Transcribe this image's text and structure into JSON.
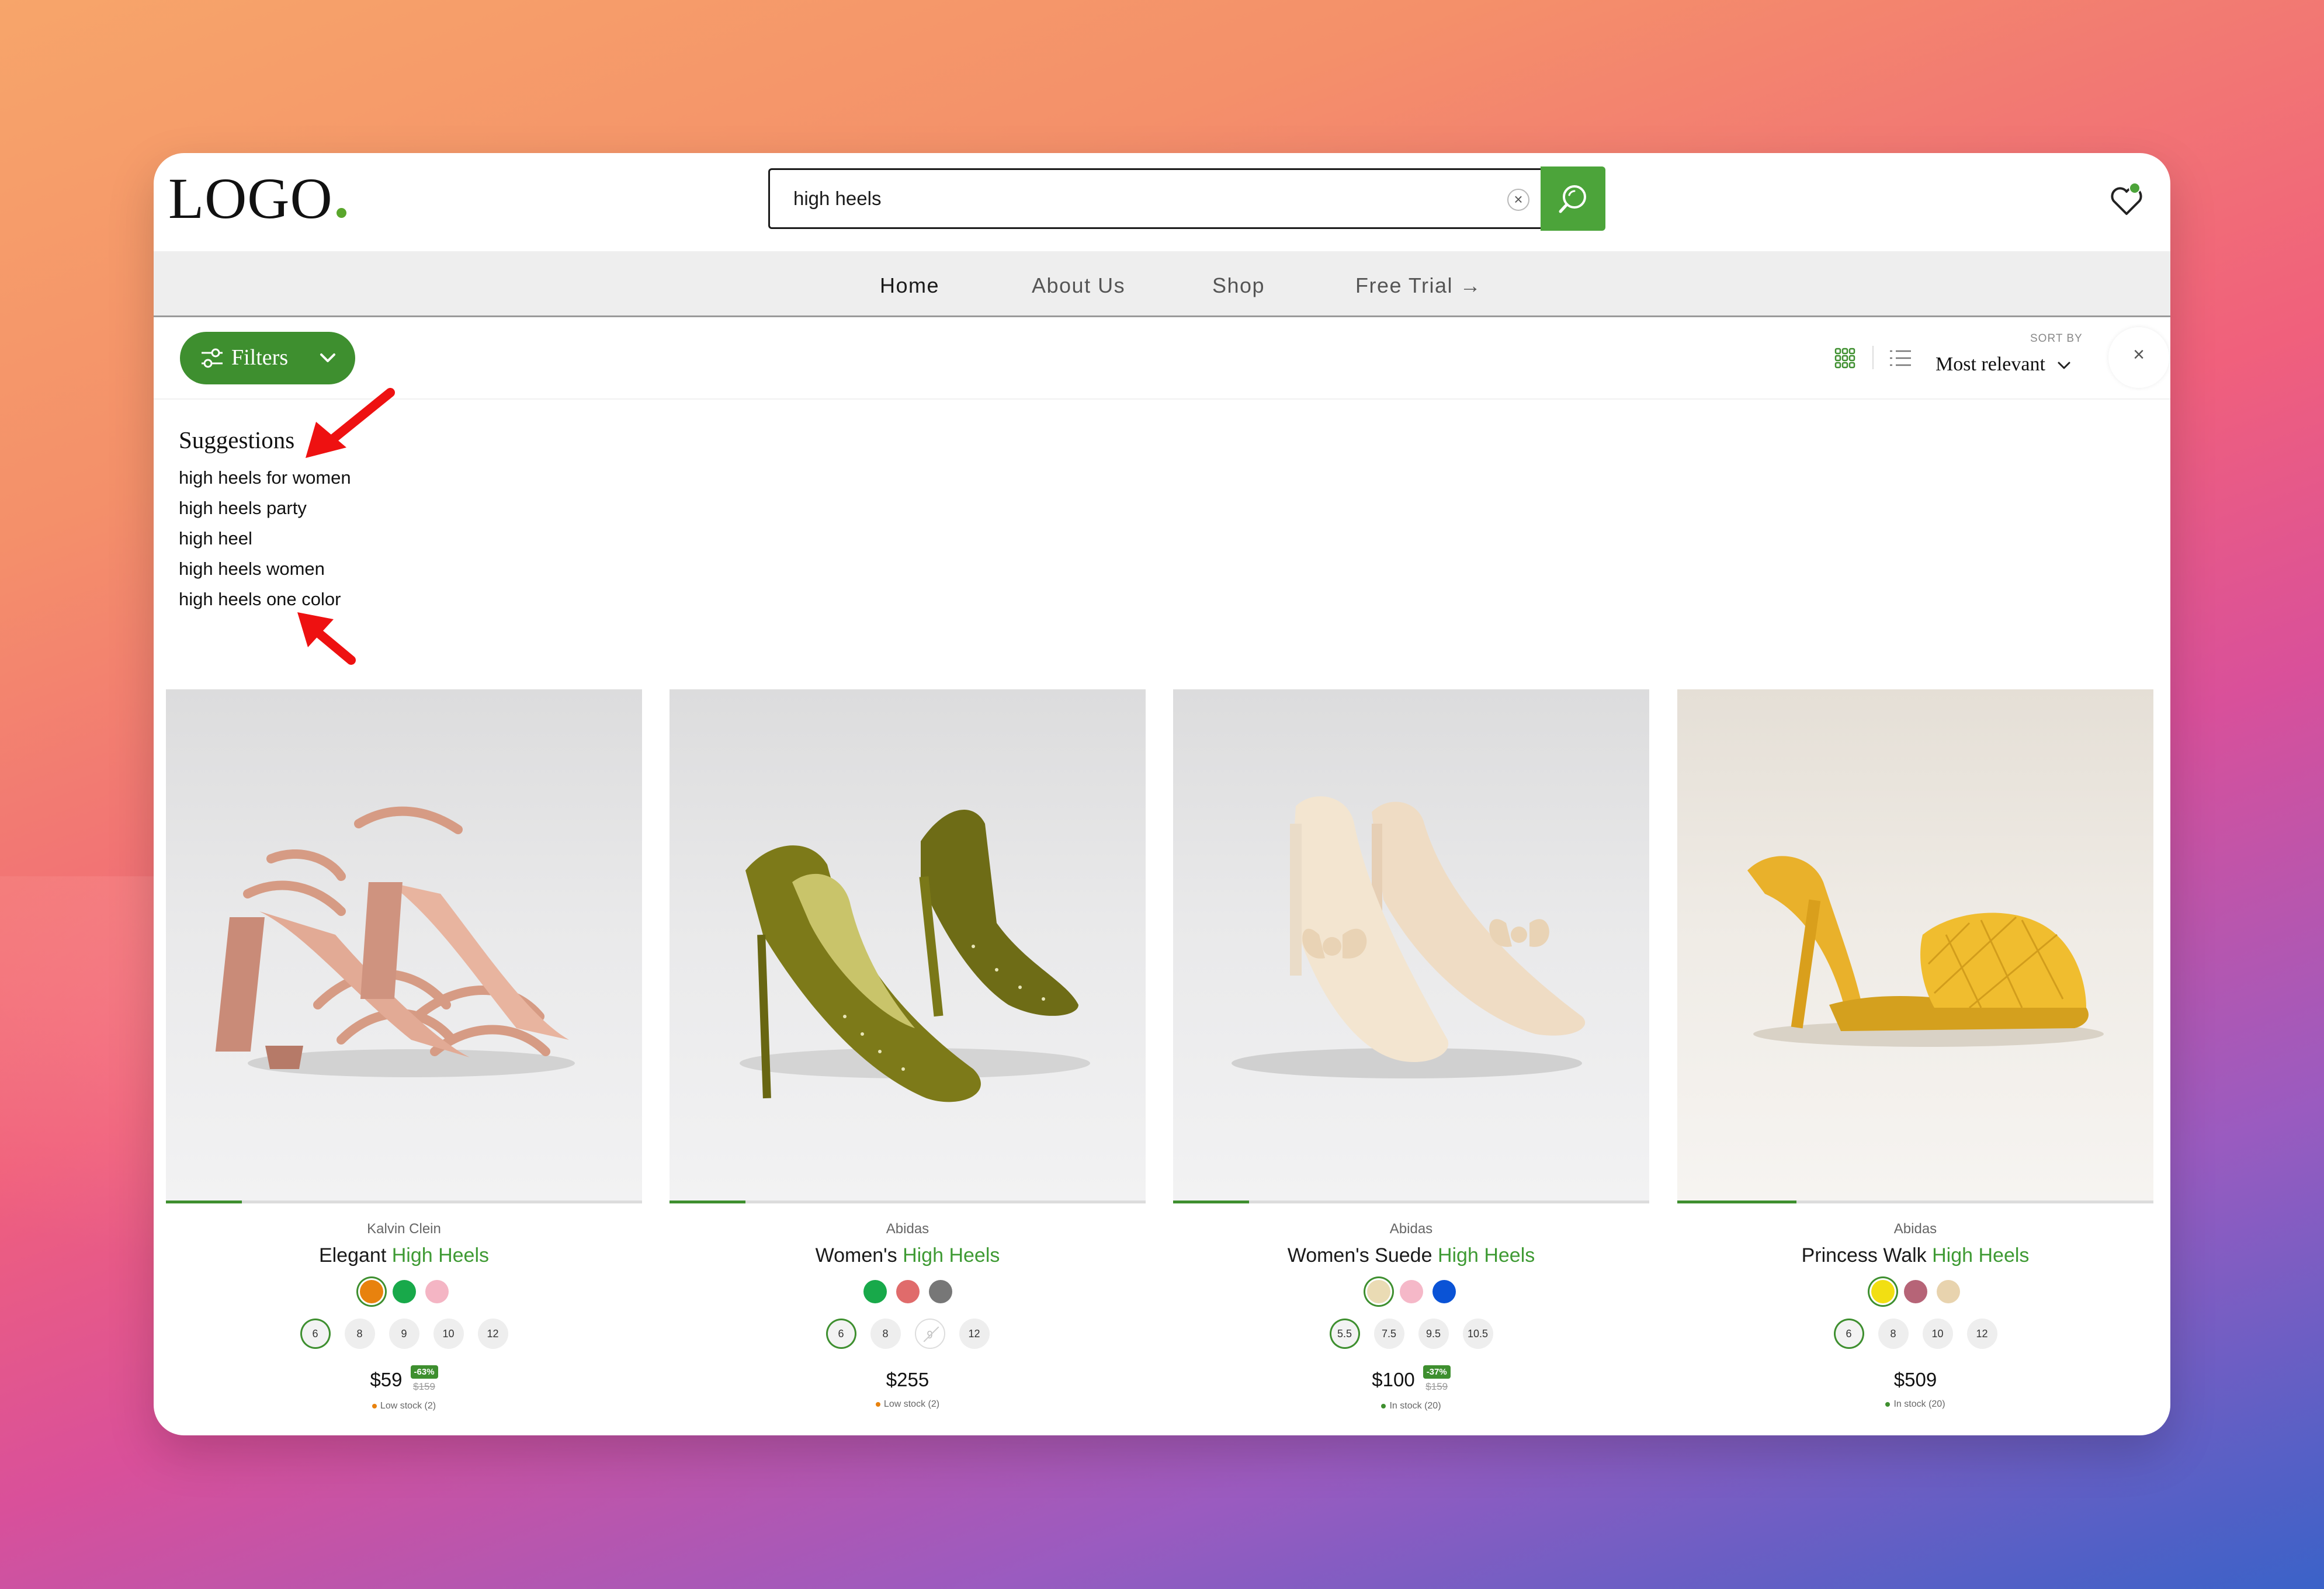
{
  "header": {
    "logo": "LOGO",
    "search_value": "high heels",
    "clear_symbol": "×"
  },
  "nav": {
    "items": [
      "Home",
      "About Us",
      "Shop",
      "Free Trial →"
    ]
  },
  "toolbar": {
    "filters_label": "Filters",
    "sort_label": "SORT BY",
    "sort_value": "Most relevant",
    "close_symbol": "×"
  },
  "suggestions": {
    "title": "Suggestions",
    "items": [
      "high heels for women",
      "high heels party",
      "high heel",
      "high heels women",
      "high heels one color"
    ]
  },
  "colors": {
    "accent": "#3e8f2f",
    "search_button": "#4ca43a",
    "highlight": "#3e9a33"
  },
  "products": [
    {
      "brand": "Kalvin Clein",
      "name_prefix": "Elegant ",
      "name_highlight": "High Heels",
      "swatches": [
        "#e8820e",
        "#18a94a",
        "#f4b5c4"
      ],
      "sizes": [
        "6",
        "8",
        "9",
        "10",
        "12"
      ],
      "price": "$59",
      "discount": "-63%",
      "old_price": "$159",
      "stock": "Low stock (2)",
      "stock_color": "#e8820e",
      "progress": 0.16
    },
    {
      "brand": "Abidas",
      "name_prefix": "Women's ",
      "name_highlight": "High Heels",
      "swatches": [
        "#18a94a",
        "#e06b6b",
        "#777777"
      ],
      "sizes": [
        "6",
        "8",
        "9",
        "12"
      ],
      "price": "$255",
      "stock": "Low stock (2)",
      "stock_color": "#e8820e",
      "progress": 0.16
    },
    {
      "brand": "Abidas",
      "name_prefix": "Women's Suede ",
      "name_highlight": "High Heels",
      "swatches": [
        "#eadbb4",
        "#f5b8c8",
        "#0a53d6"
      ],
      "sizes": [
        "5.5",
        "7.5",
        "9.5",
        "10.5"
      ],
      "price": "$100",
      "discount": "-37%",
      "old_price": "$159",
      "stock": "In stock (20)",
      "stock_color": "#3e8f2f",
      "progress": 0.16
    },
    {
      "brand": "Abidas",
      "name_prefix": "Princess Walk ",
      "name_highlight": "High Heels",
      "swatches": [
        "#f2df12",
        "#b66477",
        "#e8d3ae"
      ],
      "sizes": [
        "6",
        "8",
        "10",
        "12"
      ],
      "price": "$509",
      "stock": "In stock (20)",
      "stock_color": "#3e8f2f",
      "progress": 0.25
    }
  ]
}
